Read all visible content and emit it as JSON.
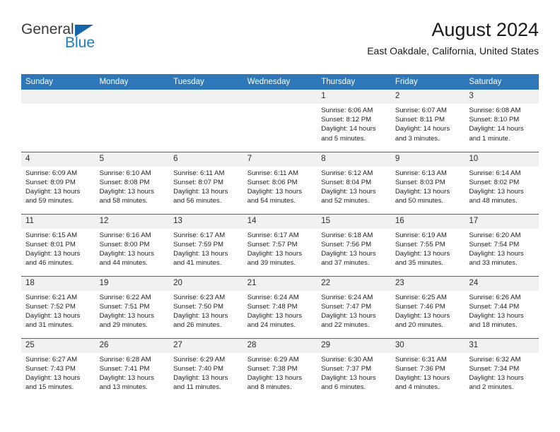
{
  "brand": {
    "name_part1": "General",
    "name_part2": "Blue",
    "triangle_color": "#1565a8",
    "blue_color": "#1b7cc4"
  },
  "header": {
    "title": "August 2024",
    "subtitle": "East Oakdale, California, United States",
    "header_bg": "#2e77b8",
    "daynum_bg": "#f1f1f1",
    "row_border": "#46698f"
  },
  "weekday_headers": [
    "Sunday",
    "Monday",
    "Tuesday",
    "Wednesday",
    "Thursday",
    "Friday",
    "Saturday"
  ],
  "calendar": {
    "month": "August",
    "year": "2024",
    "weeks": [
      [
        {
          "day": "",
          "empty": true
        },
        {
          "day": "",
          "empty": true
        },
        {
          "day": "",
          "empty": true
        },
        {
          "day": "",
          "empty": true
        },
        {
          "day": "1",
          "sunrise": "Sunrise: 6:06 AM",
          "sunset": "Sunset: 8:12 PM",
          "daylight1": "Daylight: 14 hours",
          "daylight2": "and 5 minutes."
        },
        {
          "day": "2",
          "sunrise": "Sunrise: 6:07 AM",
          "sunset": "Sunset: 8:11 PM",
          "daylight1": "Daylight: 14 hours",
          "daylight2": "and 3 minutes."
        },
        {
          "day": "3",
          "sunrise": "Sunrise: 6:08 AM",
          "sunset": "Sunset: 8:10 PM",
          "daylight1": "Daylight: 14 hours",
          "daylight2": "and 1 minute."
        }
      ],
      [
        {
          "day": "4",
          "sunrise": "Sunrise: 6:09 AM",
          "sunset": "Sunset: 8:09 PM",
          "daylight1": "Daylight: 13 hours",
          "daylight2": "and 59 minutes."
        },
        {
          "day": "5",
          "sunrise": "Sunrise: 6:10 AM",
          "sunset": "Sunset: 8:08 PM",
          "daylight1": "Daylight: 13 hours",
          "daylight2": "and 58 minutes."
        },
        {
          "day": "6",
          "sunrise": "Sunrise: 6:11 AM",
          "sunset": "Sunset: 8:07 PM",
          "daylight1": "Daylight: 13 hours",
          "daylight2": "and 56 minutes."
        },
        {
          "day": "7",
          "sunrise": "Sunrise: 6:11 AM",
          "sunset": "Sunset: 8:06 PM",
          "daylight1": "Daylight: 13 hours",
          "daylight2": "and 54 minutes."
        },
        {
          "day": "8",
          "sunrise": "Sunrise: 6:12 AM",
          "sunset": "Sunset: 8:04 PM",
          "daylight1": "Daylight: 13 hours",
          "daylight2": "and 52 minutes."
        },
        {
          "day": "9",
          "sunrise": "Sunrise: 6:13 AM",
          "sunset": "Sunset: 8:03 PM",
          "daylight1": "Daylight: 13 hours",
          "daylight2": "and 50 minutes."
        },
        {
          "day": "10",
          "sunrise": "Sunrise: 6:14 AM",
          "sunset": "Sunset: 8:02 PM",
          "daylight1": "Daylight: 13 hours",
          "daylight2": "and 48 minutes."
        }
      ],
      [
        {
          "day": "11",
          "sunrise": "Sunrise: 6:15 AM",
          "sunset": "Sunset: 8:01 PM",
          "daylight1": "Daylight: 13 hours",
          "daylight2": "and 46 minutes."
        },
        {
          "day": "12",
          "sunrise": "Sunrise: 6:16 AM",
          "sunset": "Sunset: 8:00 PM",
          "daylight1": "Daylight: 13 hours",
          "daylight2": "and 44 minutes."
        },
        {
          "day": "13",
          "sunrise": "Sunrise: 6:17 AM",
          "sunset": "Sunset: 7:59 PM",
          "daylight1": "Daylight: 13 hours",
          "daylight2": "and 41 minutes."
        },
        {
          "day": "14",
          "sunrise": "Sunrise: 6:17 AM",
          "sunset": "Sunset: 7:57 PM",
          "daylight1": "Daylight: 13 hours",
          "daylight2": "and 39 minutes."
        },
        {
          "day": "15",
          "sunrise": "Sunrise: 6:18 AM",
          "sunset": "Sunset: 7:56 PM",
          "daylight1": "Daylight: 13 hours",
          "daylight2": "and 37 minutes."
        },
        {
          "day": "16",
          "sunrise": "Sunrise: 6:19 AM",
          "sunset": "Sunset: 7:55 PM",
          "daylight1": "Daylight: 13 hours",
          "daylight2": "and 35 minutes."
        },
        {
          "day": "17",
          "sunrise": "Sunrise: 6:20 AM",
          "sunset": "Sunset: 7:54 PM",
          "daylight1": "Daylight: 13 hours",
          "daylight2": "and 33 minutes."
        }
      ],
      [
        {
          "day": "18",
          "sunrise": "Sunrise: 6:21 AM",
          "sunset": "Sunset: 7:52 PM",
          "daylight1": "Daylight: 13 hours",
          "daylight2": "and 31 minutes."
        },
        {
          "day": "19",
          "sunrise": "Sunrise: 6:22 AM",
          "sunset": "Sunset: 7:51 PM",
          "daylight1": "Daylight: 13 hours",
          "daylight2": "and 29 minutes."
        },
        {
          "day": "20",
          "sunrise": "Sunrise: 6:23 AM",
          "sunset": "Sunset: 7:50 PM",
          "daylight1": "Daylight: 13 hours",
          "daylight2": "and 26 minutes."
        },
        {
          "day": "21",
          "sunrise": "Sunrise: 6:24 AM",
          "sunset": "Sunset: 7:48 PM",
          "daylight1": "Daylight: 13 hours",
          "daylight2": "and 24 minutes."
        },
        {
          "day": "22",
          "sunrise": "Sunrise: 6:24 AM",
          "sunset": "Sunset: 7:47 PM",
          "daylight1": "Daylight: 13 hours",
          "daylight2": "and 22 minutes."
        },
        {
          "day": "23",
          "sunrise": "Sunrise: 6:25 AM",
          "sunset": "Sunset: 7:46 PM",
          "daylight1": "Daylight: 13 hours",
          "daylight2": "and 20 minutes."
        },
        {
          "day": "24",
          "sunrise": "Sunrise: 6:26 AM",
          "sunset": "Sunset: 7:44 PM",
          "daylight1": "Daylight: 13 hours",
          "daylight2": "and 18 minutes."
        }
      ],
      [
        {
          "day": "25",
          "sunrise": "Sunrise: 6:27 AM",
          "sunset": "Sunset: 7:43 PM",
          "daylight1": "Daylight: 13 hours",
          "daylight2": "and 15 minutes."
        },
        {
          "day": "26",
          "sunrise": "Sunrise: 6:28 AM",
          "sunset": "Sunset: 7:41 PM",
          "daylight1": "Daylight: 13 hours",
          "daylight2": "and 13 minutes."
        },
        {
          "day": "27",
          "sunrise": "Sunrise: 6:29 AM",
          "sunset": "Sunset: 7:40 PM",
          "daylight1": "Daylight: 13 hours",
          "daylight2": "and 11 minutes."
        },
        {
          "day": "28",
          "sunrise": "Sunrise: 6:29 AM",
          "sunset": "Sunset: 7:38 PM",
          "daylight1": "Daylight: 13 hours",
          "daylight2": "and 8 minutes."
        },
        {
          "day": "29",
          "sunrise": "Sunrise: 6:30 AM",
          "sunset": "Sunset: 7:37 PM",
          "daylight1": "Daylight: 13 hours",
          "daylight2": "and 6 minutes."
        },
        {
          "day": "30",
          "sunrise": "Sunrise: 6:31 AM",
          "sunset": "Sunset: 7:36 PM",
          "daylight1": "Daylight: 13 hours",
          "daylight2": "and 4 minutes."
        },
        {
          "day": "31",
          "sunrise": "Sunrise: 6:32 AM",
          "sunset": "Sunset: 7:34 PM",
          "daylight1": "Daylight: 13 hours",
          "daylight2": "and 2 minutes."
        }
      ]
    ]
  }
}
